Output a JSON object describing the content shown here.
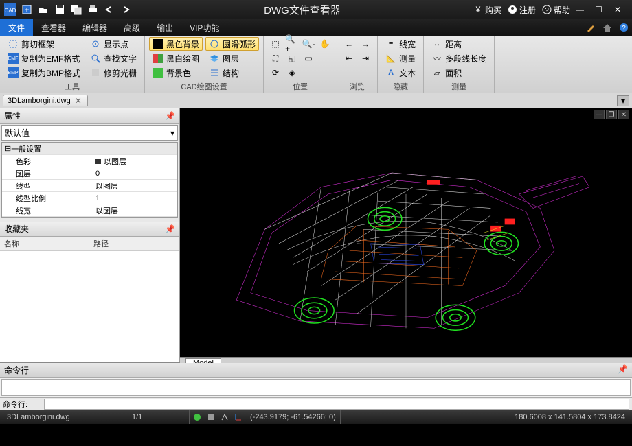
{
  "app": {
    "title": "DWG文件查看器"
  },
  "titlebar_links": {
    "buy": "购买",
    "register": "注册",
    "help": "帮助"
  },
  "menus": [
    "文件",
    "查看器",
    "编辑器",
    "高级",
    "输出",
    "VIP功能"
  ],
  "ribbon": {
    "group_tools": {
      "label": "工具",
      "items": {
        "cutframe": "剪切框架",
        "copyemf": "复制为EMF格式",
        "copybmp": "复制为BMP格式",
        "showpoint": "显示点",
        "findtext": "查找文字",
        "trimlight": "修剪光栅"
      }
    },
    "group_cad": {
      "label": "CAD绘图设置",
      "items": {
        "blackbg": "黑色背景",
        "bwdraw": "黑白绘图",
        "bgcolor": "背景色",
        "smootharc": "圆滑弧形",
        "layer": "图层",
        "struct": "结构"
      }
    },
    "group_pos": {
      "label": "位置"
    },
    "group_browse": {
      "label": "浏览"
    },
    "group_hide": {
      "label": "隐藏",
      "items": {
        "linewidth": "线宽",
        "measure": "测量",
        "text": "文本"
      }
    },
    "group_measure": {
      "label": "测量",
      "items": {
        "distance": "距离",
        "polylen": "多段线长度",
        "area": "面积"
      }
    }
  },
  "filetab": {
    "name": "3DLamborgini.dwg"
  },
  "panels": {
    "props": {
      "title": "属性",
      "combo": "默认值",
      "section": "一般设置",
      "rows": [
        {
          "k": "色彩",
          "v": "以图层"
        },
        {
          "k": "图层",
          "v": "0"
        },
        {
          "k": "线型",
          "v": "以图层"
        },
        {
          "k": "线型比例",
          "v": "1"
        },
        {
          "k": "线宽",
          "v": "以图层"
        }
      ]
    },
    "fav": {
      "title": "收藏夹",
      "col1": "名称",
      "col2": "路径"
    }
  },
  "modeltab": "Model",
  "cmd": {
    "title": "命令行",
    "prompt": "命令行:"
  },
  "status": {
    "file": "3DLamborgini.dwg",
    "page": "1/1",
    "coords": "(-243.9179; -61.54266; 0)",
    "dims": "180.6008 x 141.5804 x 173.8424"
  }
}
